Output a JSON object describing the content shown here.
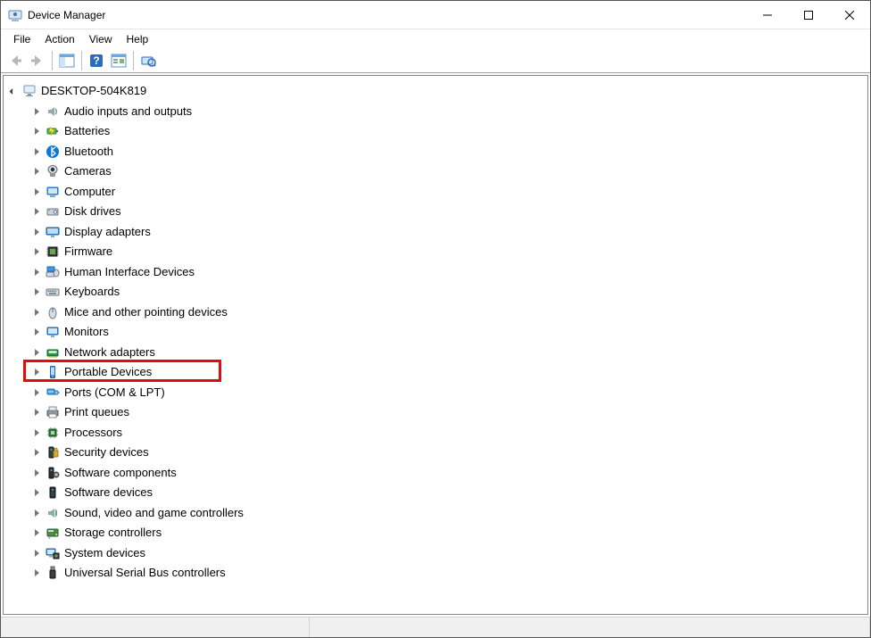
{
  "window": {
    "title": "Device Manager"
  },
  "menu": {
    "items": [
      "File",
      "Action",
      "View",
      "Help"
    ]
  },
  "toolbar": {
    "buttons": [
      {
        "name": "nav-back",
        "icon": "arrow-left",
        "enabled": false
      },
      {
        "name": "nav-forward",
        "icon": "arrow-right",
        "enabled": false
      },
      {
        "name": "sep"
      },
      {
        "name": "show-hide-tree",
        "icon": "tree-pane",
        "enabled": true
      },
      {
        "name": "sep"
      },
      {
        "name": "help",
        "icon": "help",
        "enabled": true
      },
      {
        "name": "properties",
        "icon": "props",
        "enabled": true
      },
      {
        "name": "sep"
      },
      {
        "name": "scan-hardware",
        "icon": "scan",
        "enabled": true
      }
    ]
  },
  "tree": {
    "root": {
      "label": "DESKTOP-504K819",
      "icon": "computer-root",
      "children": [
        {
          "label": "Audio inputs and outputs",
          "icon": "audio"
        },
        {
          "label": "Batteries",
          "icon": "battery"
        },
        {
          "label": "Bluetooth",
          "icon": "bluetooth"
        },
        {
          "label": "Cameras",
          "icon": "camera"
        },
        {
          "label": "Computer",
          "icon": "computer"
        },
        {
          "label": "Disk drives",
          "icon": "disk"
        },
        {
          "label": "Display adapters",
          "icon": "display"
        },
        {
          "label": "Firmware",
          "icon": "firmware"
        },
        {
          "label": "Human Interface Devices",
          "icon": "hid"
        },
        {
          "label": "Keyboards",
          "icon": "keyboard"
        },
        {
          "label": "Mice and other pointing devices",
          "icon": "mouse"
        },
        {
          "label": "Monitors",
          "icon": "monitor"
        },
        {
          "label": "Network adapters",
          "icon": "network"
        },
        {
          "label": "Portable Devices",
          "icon": "portable",
          "highlighted": true
        },
        {
          "label": "Ports (COM & LPT)",
          "icon": "ports"
        },
        {
          "label": "Print queues",
          "icon": "printer"
        },
        {
          "label": "Processors",
          "icon": "cpu"
        },
        {
          "label": "Security devices",
          "icon": "security"
        },
        {
          "label": "Software components",
          "icon": "swcomp"
        },
        {
          "label": "Software devices",
          "icon": "swdev"
        },
        {
          "label": "Sound, video and game controllers",
          "icon": "sound"
        },
        {
          "label": "Storage controllers",
          "icon": "storage"
        },
        {
          "label": "System devices",
          "icon": "system"
        },
        {
          "label": "Universal Serial Bus controllers",
          "icon": "usb"
        }
      ]
    }
  },
  "highlight": {
    "target_label": "Portable Devices"
  }
}
